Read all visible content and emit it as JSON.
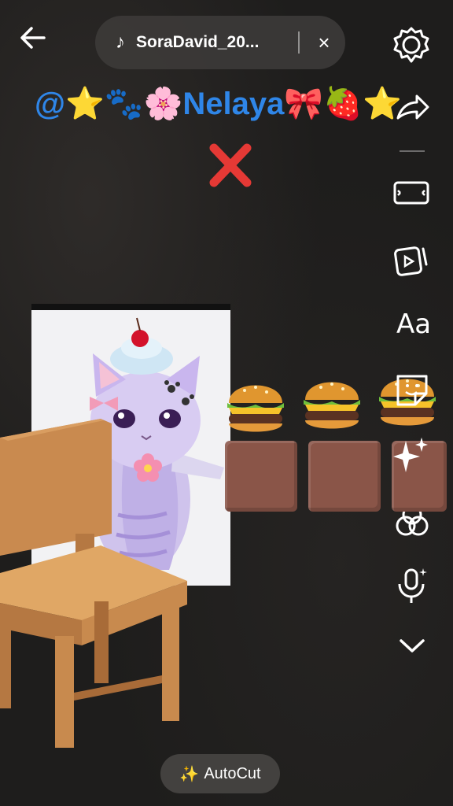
{
  "header": {
    "music_title": "SoraDavid_20...",
    "close_label": "×"
  },
  "overlay": {
    "username_text": "@⭐🐾🌸Nelaya🎀🍓⭐"
  },
  "sidebar": {
    "text_tool_label": "Aa",
    "items": [
      "share",
      "aspect-ratio",
      "template",
      "text",
      "sticker",
      "effects",
      "filters",
      "voice-effects",
      "more"
    ]
  },
  "footer": {
    "autocut_label": "AutoCut",
    "autocut_icon": "✨"
  },
  "colors": {
    "username_blue": "#2f86e8",
    "block_brown": "#8a5548",
    "red_x": "#e53935"
  }
}
